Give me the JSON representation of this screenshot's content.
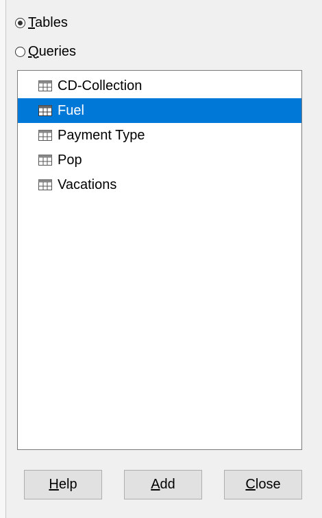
{
  "source_type": {
    "tables": {
      "acc": "T",
      "rest": "ables",
      "checked": true
    },
    "queries": {
      "acc": "Q",
      "rest": "ueries",
      "checked": false
    }
  },
  "list": {
    "items": [
      {
        "label": "CD-Collection",
        "icon": "table-icon",
        "selected": false
      },
      {
        "label": "Fuel",
        "icon": "table-icon",
        "selected": true
      },
      {
        "label": "Payment Type",
        "icon": "table-icon",
        "selected": false
      },
      {
        "label": "Pop",
        "icon": "table-icon",
        "selected": false
      },
      {
        "label": "Vacations",
        "icon": "table-icon",
        "selected": false
      }
    ]
  },
  "buttons": {
    "help": {
      "acc": "H",
      "rest": "elp"
    },
    "add": {
      "acc": "A",
      "rest": "dd"
    },
    "close": {
      "acc": "C",
      "rest": "lose"
    }
  },
  "colors": {
    "selection": "#0078d7",
    "background": "#f0f0f0",
    "button": "#e1e1e1"
  }
}
